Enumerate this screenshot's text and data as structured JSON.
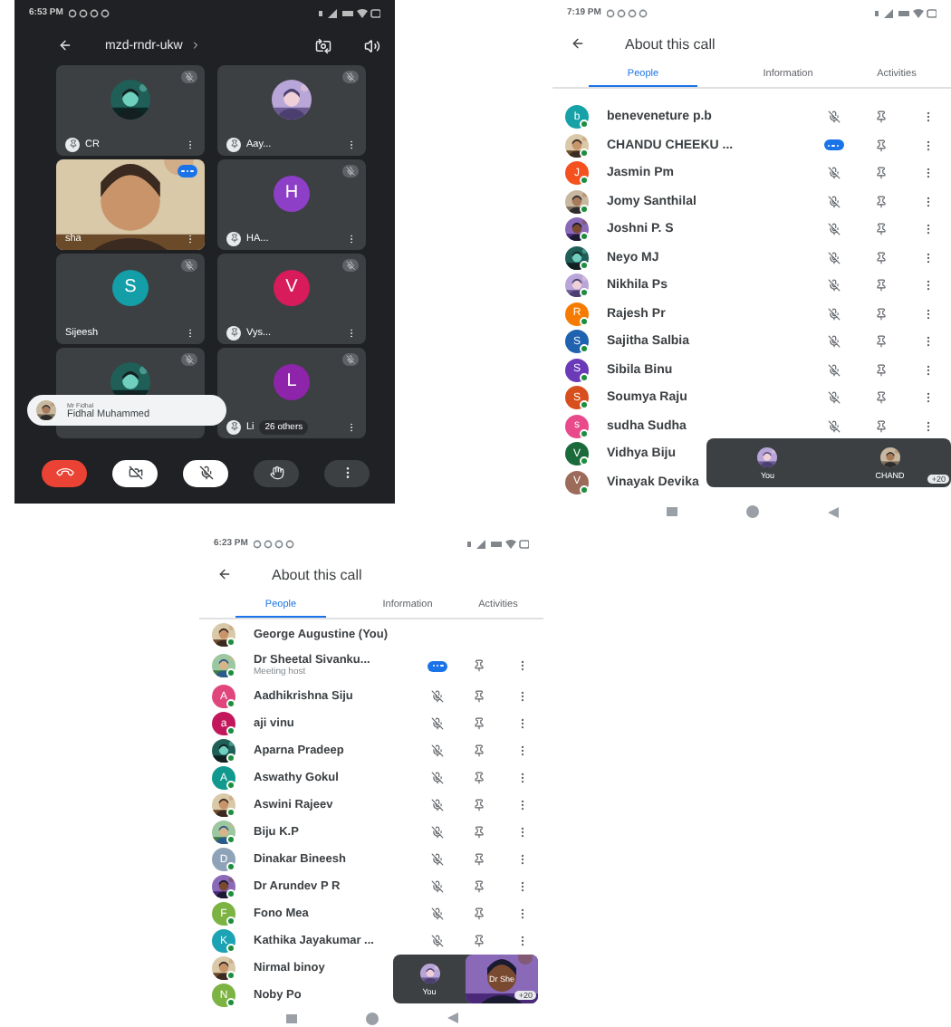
{
  "screens": [
    {
      "kind": "call",
      "status_time": "6:53 PM",
      "meeting_code": "mzd-rndr-ukw",
      "tiles": [
        {
          "name": "CR",
          "muted": true,
          "speaking": false,
          "pin": true
        },
        {
          "name": "Aay...",
          "muted": true,
          "speaking": false,
          "pin": true
        },
        {
          "name": "sha",
          "avatar": {
            "kind": "video"
          },
          "muted": false,
          "speaking": true,
          "pin": false
        },
        {
          "name": "HA...",
          "avatar": {
            "kind": "letter",
            "letter": "H",
            "color": "#8e3fc8"
          },
          "muted": true,
          "speaking": false,
          "pin": true
        },
        {
          "name": "Sijeesh",
          "avatar": {
            "kind": "letter",
            "letter": "S",
            "color": "#149ea8"
          },
          "muted": true,
          "speaking": false,
          "pin": false
        },
        {
          "name": "Vys...",
          "avatar": {
            "kind": "letter",
            "letter": "V",
            "color": "#d81b5a"
          },
          "muted": true,
          "speaking": false,
          "pin": true
        },
        {
          "muted": true,
          "speaking": false
        },
        {
          "name": "Li",
          "avatar": {
            "kind": "letter",
            "letter": "L",
            "color": "#8e24aa"
          },
          "muted": true,
          "speaking": false,
          "pin": true,
          "others": "26 others"
        }
      ],
      "toast": {
        "caption": "Mr Fidhal",
        "name": "Fidhal Muhammed"
      },
      "controls": [
        {
          "kind": "end"
        },
        {
          "kind": "camera_off"
        },
        {
          "kind": "mic_off"
        },
        {
          "kind": "hand"
        },
        {
          "kind": "more"
        }
      ]
    },
    {
      "kind": "people",
      "status_time": "7:19 PM",
      "title": "About this call",
      "tabs": [
        {
          "label": "People",
          "selected": true
        },
        {
          "label": "Information",
          "selected": false
        },
        {
          "label": "Activities",
          "selected": false
        }
      ],
      "rows": [
        {
          "name": "beneveneture p.b",
          "avatar": {
            "kind": "letter",
            "letter": "b",
            "color": "#17a2a8"
          },
          "muted": true,
          "speaking": false,
          "actions": true
        },
        {
          "name": "CHANDU CHEEKU ...",
          "muted": false,
          "speaking": true,
          "actions": true
        },
        {
          "name": "Jasmin Pm",
          "avatar": {
            "kind": "letter",
            "letter": "J",
            "color": "#f4511e"
          },
          "muted": true,
          "speaking": false,
          "actions": true
        },
        {
          "name": "Jomy Santhilal",
          "muted": true,
          "speaking": false,
          "actions": true
        },
        {
          "name": "Joshni P. S",
          "muted": true,
          "speaking": false,
          "actions": true
        },
        {
          "name": "Neyo MJ",
          "muted": true,
          "speaking": false,
          "actions": true
        },
        {
          "name": "Nikhila Ps",
          "muted": true,
          "speaking": false,
          "actions": true
        },
        {
          "name": "Rajesh Pr",
          "avatar": {
            "kind": "letter",
            "letter": "R",
            "color": "#f57c00"
          },
          "muted": true,
          "speaking": false,
          "actions": true
        },
        {
          "name": "Sajitha Salbia",
          "avatar": {
            "kind": "letter",
            "letter": "S",
            "color": "#1e62b0"
          },
          "muted": true,
          "speaking": false,
          "actions": true
        },
        {
          "name": "Sibila Binu",
          "avatar": {
            "kind": "letter",
            "letter": "S",
            "color": "#6a3ab8"
          },
          "muted": true,
          "speaking": false,
          "actions": true
        },
        {
          "name": "Soumya Raju",
          "avatar": {
            "kind": "letter",
            "letter": "S",
            "color": "#d84f1e"
          },
          "muted": true,
          "speaking": false,
          "actions": true
        },
        {
          "name": "sudha Sudha",
          "avatar": {
            "kind": "letter",
            "letter": "s",
            "color": "#e84a8a"
          },
          "muted": true,
          "speaking": false,
          "actions": true
        },
        {
          "name": "Vidhya Biju",
          "avatar": {
            "kind": "letter",
            "letter": "V",
            "color": "#1b6b3a"
          },
          "actions": false
        },
        {
          "name": "Vinayak Devika",
          "avatar": {
            "kind": "letter",
            "letter": "V",
            "color": "#9c6b5a"
          },
          "actions": false
        }
      ],
      "pip": {
        "tiles": [
          {
            "label": "You",
            "kind": "picture"
          },
          {
            "label": "CHAND",
            "kind": "picture",
            "badge": "+20"
          }
        ]
      }
    },
    {
      "kind": "people",
      "status_time": "6:23 PM",
      "title": "About this call",
      "tabs": [
        {
          "label": "People",
          "selected": true
        },
        {
          "label": "Information",
          "selected": false
        },
        {
          "label": "Activities",
          "selected": false
        }
      ],
      "rows": [
        {
          "name": "George Augustine (You)",
          "actions": false
        },
        {
          "name": "Dr Sheetal Sivanku...",
          "subtitle": "Meeting host",
          "muted": false,
          "speaking": true,
          "actions": true
        },
        {
          "name": "Aadhikrishna Siju",
          "avatar": {
            "kind": "letter",
            "letter": "A",
            "color": "#e0457b"
          },
          "muted": true,
          "speaking": false,
          "actions": true
        },
        {
          "name": "aji vinu",
          "avatar": {
            "kind": "letter",
            "letter": "a",
            "color": "#c2185b"
          },
          "muted": true,
          "speaking": false,
          "actions": true
        },
        {
          "name": "Aparna Pradeep",
          "muted": true,
          "speaking": false,
          "actions": true
        },
        {
          "name": "Aswathy Gokul",
          "avatar": {
            "kind": "letter",
            "letter": "A",
            "color": "#12998f"
          },
          "muted": true,
          "speaking": false,
          "actions": true
        },
        {
          "name": "Aswini Rajeev",
          "muted": true,
          "speaking": false,
          "actions": true
        },
        {
          "name": "Biju K.P",
          "muted": true,
          "speaking": false,
          "actions": true
        },
        {
          "name": "Dinakar Bineesh",
          "avatar": {
            "kind": "letter",
            "letter": "D",
            "color": "#8fa3b8"
          },
          "muted": true,
          "speaking": false,
          "actions": true
        },
        {
          "name": "Dr Arundev P R",
          "muted": true,
          "speaking": false,
          "actions": true
        },
        {
          "name": "Fono Mea",
          "avatar": {
            "kind": "letter",
            "letter": "F",
            "color": "#7cb342"
          },
          "muted": true,
          "speaking": false,
          "actions": true
        },
        {
          "name": "Kathika Jayakumar ...",
          "avatar": {
            "kind": "letter",
            "letter": "K",
            "color": "#1ba3b5"
          },
          "muted": true,
          "speaking": false,
          "actions": true
        },
        {
          "name": "Nirmal binoy",
          "actions": false
        },
        {
          "name": "Noby Po",
          "avatar": {
            "kind": "letter",
            "letter": "N",
            "color": "#7cb342"
          },
          "actions": false
        }
      ],
      "pip": {
        "tiles": [
          {
            "label": "You",
            "kind": "picture"
          },
          {
            "label": "Dr She",
            "kind": "video",
            "badge": "+20"
          }
        ]
      }
    }
  ]
}
